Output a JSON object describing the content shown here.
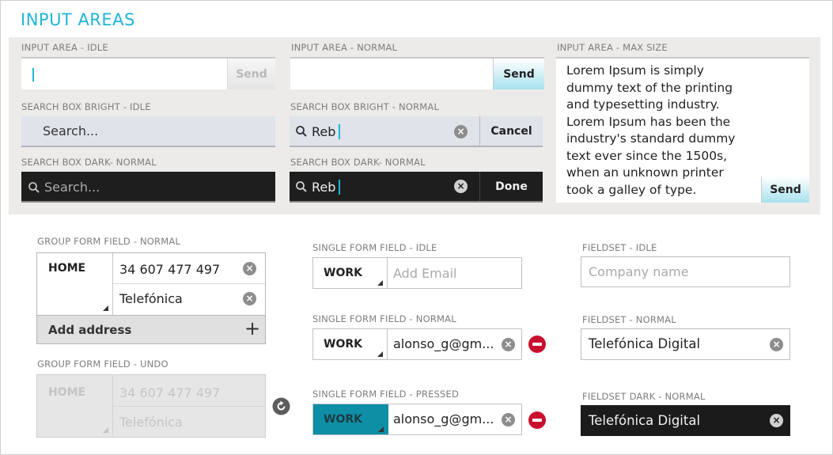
{
  "title": "INPUT AREAS",
  "input_area_idle": {
    "label": "INPUT AREA - IDLE",
    "send": "Send"
  },
  "input_area_normal": {
    "label": "INPUT AREA - NORMAL",
    "send": "Send"
  },
  "input_area_max": {
    "label": "INPUT AREA - MAX SIZE",
    "lines": [
      "Lorem Ipsum is simply",
      "dummy text of the printing",
      "and typesetting industry.",
      "Lorem Ipsum has been the",
      "industry's standard dummy",
      "text ever since the 1500s,",
      "when an unknown printer",
      "took a galley of type."
    ],
    "send": "Send"
  },
  "search_bright_idle": {
    "label": "SEARCH BOX BRIGHT - IDLE",
    "placeholder": "Search..."
  },
  "search_bright_normal": {
    "label": "SEARCH BOX BRIGHT - NORMAL",
    "value": "Reb",
    "button": "Cancel"
  },
  "search_dark_normal_idle": {
    "label": "SEARCH BOX DARK- NORMAL",
    "placeholder": "Search..."
  },
  "search_dark_normal": {
    "label": "SEARCH BOX DARK- NORMAL",
    "value": "Reb",
    "button": "Done"
  },
  "group_form_normal": {
    "label": "GROUP FORM FIELD - NORMAL",
    "type": "HOME",
    "phone": "34 607 477 497",
    "carrier": "Telefónica",
    "add": "Add address",
    "add_icon": "+"
  },
  "group_form_undo": {
    "label": "GROUP FORM FIELD - UNDO",
    "type": "HOME",
    "phone": "34 607 477 497",
    "carrier": "Telefónica"
  },
  "single_idle": {
    "label": "SINGLE FORM FIELD - IDLE",
    "type": "WORK",
    "placeholder": "Add Email"
  },
  "single_normal": {
    "label": "SINGLE FORM FIELD - NORMAL",
    "type": "WORK",
    "value": "alonso_g@gm..."
  },
  "single_pressed": {
    "label": "SINGLE FORM FIELD - PRESSED",
    "type": "WORK",
    "value": "alonso_g@gm..."
  },
  "fieldset_idle": {
    "label": "FIELDSET - IDLE",
    "placeholder": "Company name"
  },
  "fieldset_normal": {
    "label": "FIELDSET - NORMAL",
    "value": "Telefónica Digital"
  },
  "fieldset_dark": {
    "label": "FIELDSET DARK - NORMAL",
    "value": "Telefónica Digital"
  },
  "icons": {
    "clear": "×",
    "search": "search-icon",
    "remove": "minus-circle-icon",
    "undo": "undo-icon"
  },
  "colors": {
    "accent": "#1fb5d6",
    "pressed": "#0e8fa6",
    "remove": "#c8102e",
    "dark": "#1e1e1e"
  }
}
